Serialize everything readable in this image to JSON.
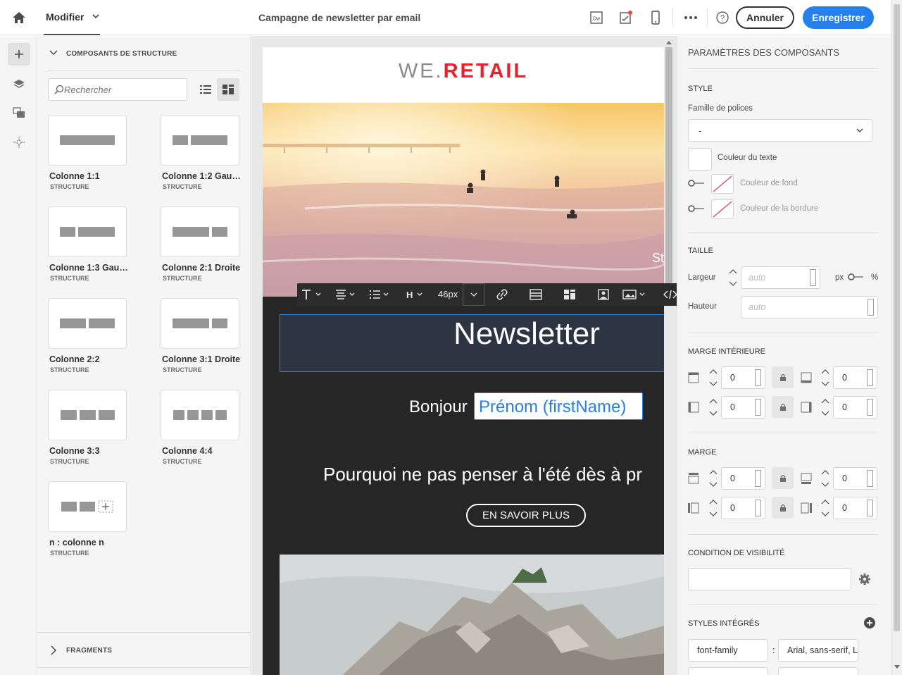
{
  "topbar": {
    "mode_label": "Modifier",
    "title": "Campagne de newsletter par email",
    "cancel_label": "Annuler",
    "save_label": "Enregistrer",
    "icons": [
      "home-icon",
      "chevron-down-icon",
      "dw-icon",
      "proof-icon",
      "mobile-icon",
      "more-icon",
      "help-icon"
    ]
  },
  "left_panel": {
    "section_title": "COMPOSANTS DE STRUCTURE",
    "search_placeholder": "Rechercher",
    "components": [
      {
        "label": "Colonne 1:1",
        "sub": "STRUCTURE"
      },
      {
        "label": "Colonne 1:2 Gau…",
        "sub": "STRUCTURE"
      },
      {
        "label": "Colonne 1:3 Gau…",
        "sub": "STRUCTURE"
      },
      {
        "label": "Colonne 2:1 Droite",
        "sub": "STRUCTURE"
      },
      {
        "label": "Colonne 2:2",
        "sub": "STRUCTURE"
      },
      {
        "label": "Colonne 3:1 Droite",
        "sub": "STRUCTURE"
      },
      {
        "label": "Colonne 3:3",
        "sub": "STRUCTURE"
      },
      {
        "label": "Colonne 4:4",
        "sub": "STRUCTURE"
      },
      {
        "label": "n : colonne n",
        "sub": "STRUCTURE"
      }
    ],
    "fragments_title": "FRAGMENTS"
  },
  "email": {
    "brand_prefix": "WE.",
    "brand_suffix": "RETAIL",
    "headline": "Newsletter",
    "greeting": "Bonjour",
    "firstname_token": "Prénom (firstName)",
    "teaser": "Pourquoi ne pas penser à l'été dès à pr",
    "cta": "EN SAVOIR PLUS",
    "hero_text": "St"
  },
  "rte_toolbar": {
    "font_size": "46px"
  },
  "right_panel": {
    "title": "PARAMÈTRES DES COMPOSANTS",
    "style_section": "STYLE",
    "font_family_label": "Famille de polices",
    "font_family_value": "-",
    "text_color_label": "Couleur du texte",
    "bg_color_label": "Couleur de fond",
    "border_color_label": "Couleur de la bordure",
    "size_section": "TAILLE",
    "width_label": "Largeur",
    "width_placeholder": "auto",
    "height_label": "Hauteur",
    "height_placeholder": "auto",
    "unit_px": "px",
    "unit_pct": "%",
    "padding_section": "MARGE INTÉRIEURE",
    "padding_values": [
      "0",
      "0",
      "0",
      "0"
    ],
    "margin_section": "MARGE",
    "margin_values": [
      "0",
      "0",
      "0",
      "0"
    ],
    "visibility_section": "CONDITION DE VISIBILITÉ",
    "inline_styles_section": "STYLES INTÉGRÉS",
    "inline_style_key": "font-family",
    "inline_style_sep": ":",
    "inline_style_value": "Arial, sans-serif, La"
  },
  "colors": {
    "accent": "#2680eb",
    "brand_red": "#e8212e",
    "email_dark": "#262626",
    "selection": "#2680eb"
  }
}
